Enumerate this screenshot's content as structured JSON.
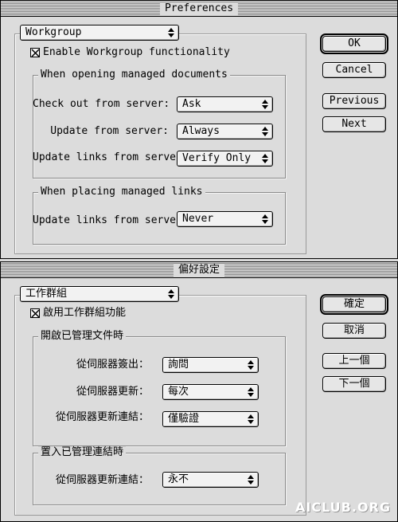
{
  "en": {
    "window_title": "Preferences",
    "category": "Workgroup",
    "enable_label": "Enable Workgroup functionality",
    "enable_checked": true,
    "opening_group": "When opening managed documents",
    "checkout_label": "Check out from server:",
    "checkout_value": "Ask",
    "update_label": "Update from server:",
    "update_value": "Always",
    "links_label": "Update links from server:",
    "links_value": "Verify Only",
    "placing_group": "When placing managed links",
    "placing_links_label": "Update links from server:",
    "placing_links_value": "Never",
    "ok": "OK",
    "cancel": "Cancel",
    "previous": "Previous",
    "next": "Next"
  },
  "zh": {
    "window_title": "偏好設定",
    "category": "工作群組",
    "enable_label": "啟用工作群組功能",
    "enable_checked": true,
    "opening_group": "開啟已管理文件時",
    "checkout_label": "從伺服器簽出：",
    "checkout_value": "詢問",
    "update_label": "從伺服器更新：",
    "update_value": "每次",
    "links_label": "從伺服器更新連結：",
    "links_value": "僅驗證",
    "placing_group": "置入已管理連結時",
    "placing_links_label": "從伺服器更新連結：",
    "placing_links_value": "永不",
    "ok": "確定",
    "cancel": "取消",
    "previous": "上一個",
    "next": "下一個"
  },
  "watermark": "AICLUB.ORG"
}
